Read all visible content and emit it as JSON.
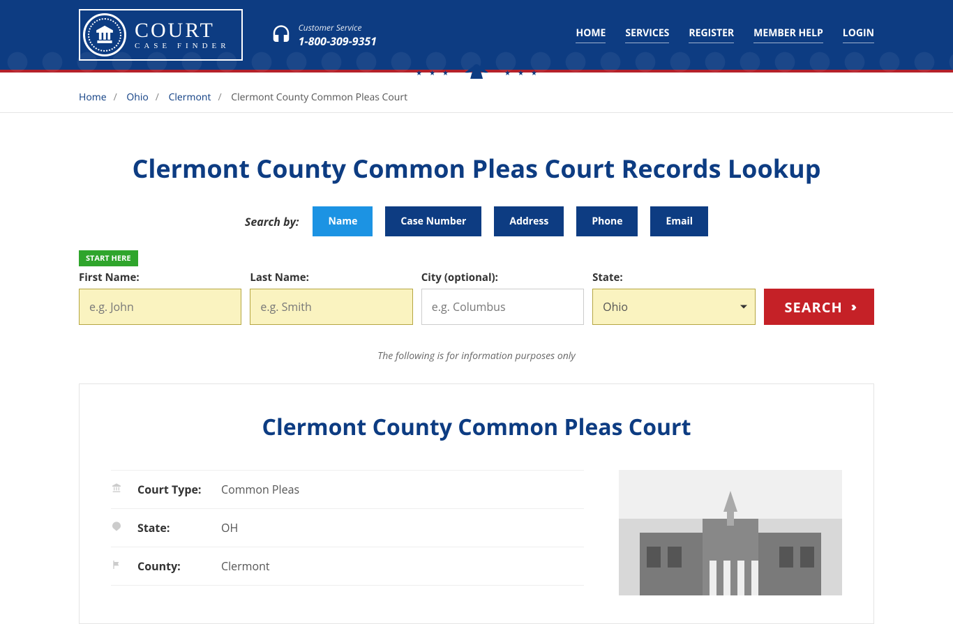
{
  "header": {
    "logo": {
      "line1": "COURT",
      "line2": "CASE FINDER"
    },
    "support": {
      "label": "Customer Service",
      "phone": "1-800-309-9351"
    },
    "nav": [
      "HOME",
      "SERVICES",
      "REGISTER",
      "MEMBER HELP",
      "LOGIN"
    ]
  },
  "breadcrumb": {
    "items": [
      "Home",
      "Ohio",
      "Clermont"
    ],
    "current": "Clermont County Common Pleas Court"
  },
  "page": {
    "title": "Clermont County Common Pleas Court Records Lookup",
    "search_by_label": "Search by:",
    "tabs": [
      "Name",
      "Case Number",
      "Address",
      "Phone",
      "Email"
    ],
    "active_tab": 0,
    "start_here": "START HERE",
    "form": {
      "first": {
        "label": "First Name:",
        "placeholder": "e.g. John"
      },
      "last": {
        "label": "Last Name:",
        "placeholder": "e.g. Smith"
      },
      "city": {
        "label": "City (optional):",
        "placeholder": "e.g. Columbus"
      },
      "state": {
        "label": "State:",
        "value": "Ohio"
      },
      "button": "SEARCH"
    },
    "disclaimer": "The following is for information purposes only"
  },
  "court": {
    "heading": "Clermont County Common Pleas Court",
    "rows": [
      {
        "k": "Court Type:",
        "v": "Common Pleas"
      },
      {
        "k": "State:",
        "v": "OH"
      },
      {
        "k": "County:",
        "v": "Clermont"
      }
    ]
  }
}
